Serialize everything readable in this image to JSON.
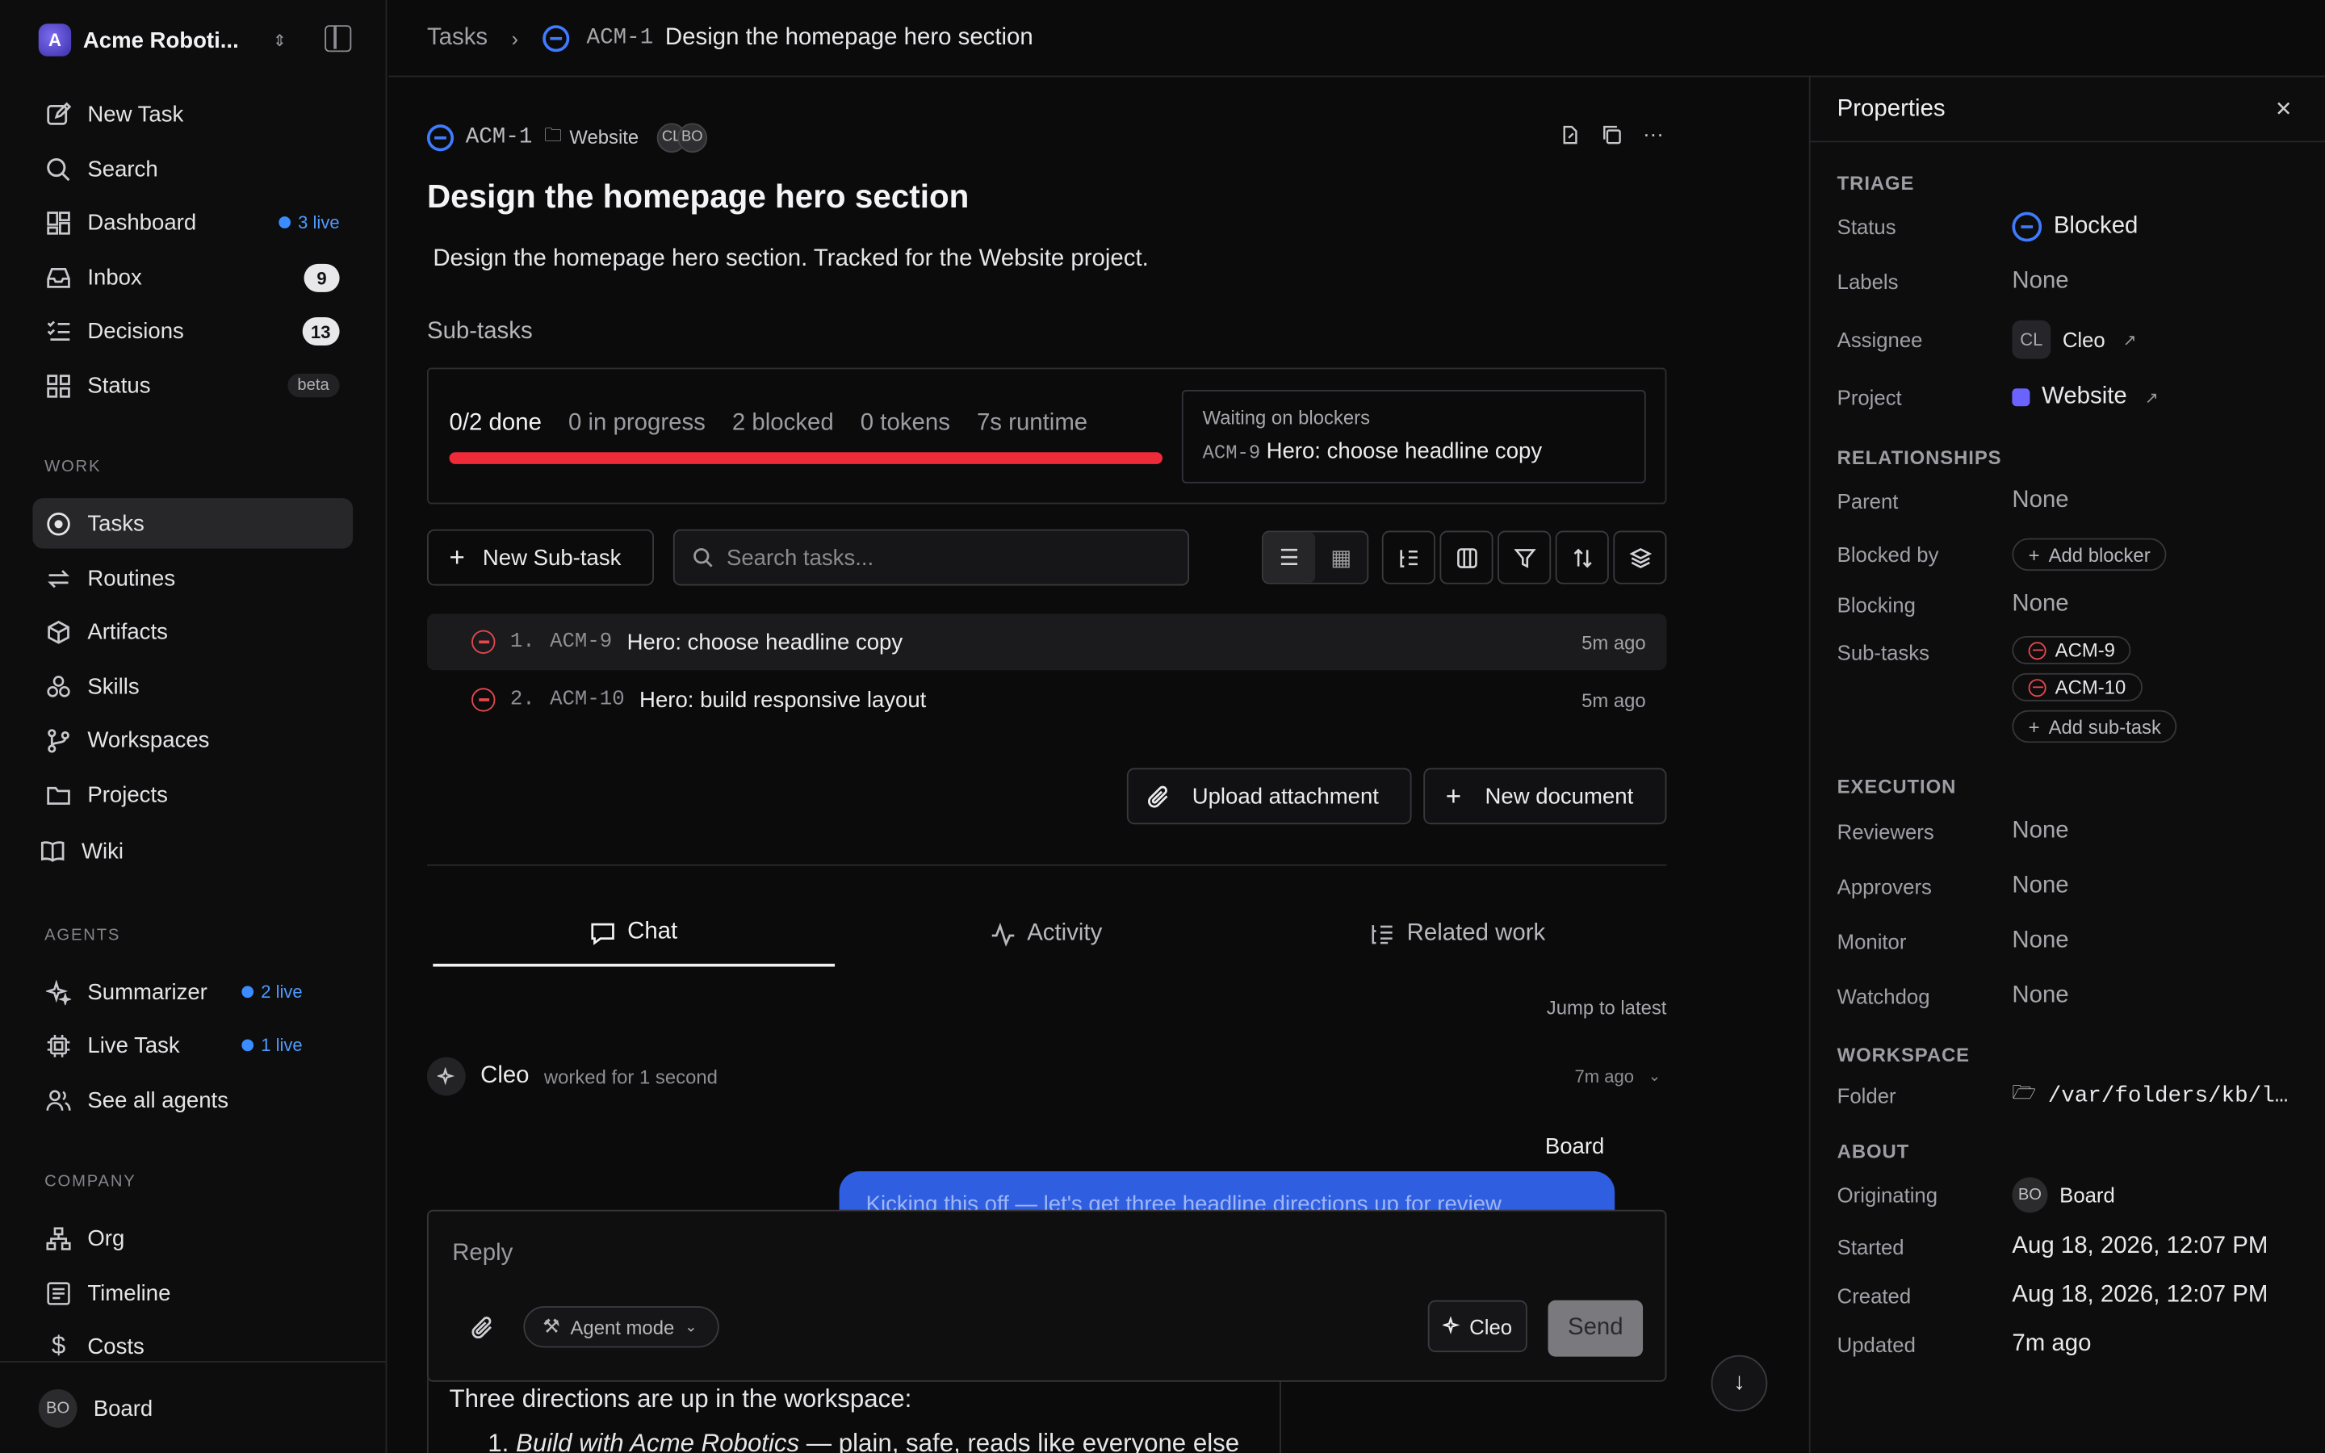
{
  "workspace": {
    "name": "Acme Roboti...",
    "logo_letter": "A"
  },
  "sidebar": {
    "top": [
      {
        "label": "New Task",
        "icon": "pencil-square-icon"
      },
      {
        "label": "Search",
        "icon": "search-icon"
      },
      {
        "label": "Dashboard",
        "icon": "dashboard-icon",
        "live": "3 live"
      },
      {
        "label": "Inbox",
        "icon": "inbox-icon",
        "badge": "9"
      },
      {
        "label": "Decisions",
        "icon": "checklist-icon",
        "badge": "13"
      },
      {
        "label": "Status",
        "icon": "grid-icon",
        "tag": "beta"
      }
    ],
    "work_label": "WORK",
    "work": [
      {
        "label": "Tasks",
        "icon": "target-icon",
        "active": true
      },
      {
        "label": "Routines",
        "icon": "repeat-icon"
      },
      {
        "label": "Artifacts",
        "icon": "cube-icon"
      },
      {
        "label": "Skills",
        "icon": "skills-icon"
      },
      {
        "label": "Workspaces",
        "icon": "branch-icon"
      },
      {
        "label": "Projects",
        "icon": "folder-icon"
      },
      {
        "label": "Wiki",
        "icon": "book-icon"
      }
    ],
    "agents_label": "AGENTS",
    "agents": [
      {
        "label": "Summarizer",
        "icon": "sparkle-icon",
        "live": "2 live"
      },
      {
        "label": "Live Task",
        "icon": "chip-icon",
        "live": "1 live"
      },
      {
        "label": "See all agents",
        "icon": "users-icon"
      }
    ],
    "company_label": "COMPANY",
    "company": [
      {
        "label": "Org",
        "icon": "org-icon"
      },
      {
        "label": "Timeline",
        "icon": "timeline-icon"
      },
      {
        "label": "Costs",
        "icon": "dollar-icon"
      }
    ],
    "user": {
      "initials": "BO",
      "name": "Board"
    }
  },
  "breadcrumb": {
    "root": "Tasks",
    "id": "ACM-1",
    "title": "Design the homepage hero section"
  },
  "task": {
    "id": "ACM-1",
    "project": "Website",
    "avatars": [
      "CL",
      "BO"
    ],
    "title": "Design the homepage hero section",
    "description": "Design the homepage hero section. Tracked for the Website project."
  },
  "subtasks": {
    "label": "Sub-tasks",
    "stats": {
      "done": "0/2 done",
      "in_progress": "0 in progress",
      "blocked": "2 blocked",
      "tokens": "0 tokens",
      "runtime": "7s runtime"
    },
    "progress_blocked_fraction": 1.0,
    "blockers_title": "Waiting on blockers",
    "blocker_id": "ACM-9",
    "blocker_title": "Hero: choose headline copy",
    "new_subtask_label": "New Sub-task",
    "search_placeholder": "Search tasks...",
    "rows": [
      {
        "num": "1.",
        "id": "ACM-9",
        "title": "Hero: choose headline copy",
        "time": "5m ago"
      },
      {
        "num": "2.",
        "id": "ACM-10",
        "title": "Hero: build responsive layout",
        "time": "5m ago"
      }
    ],
    "upload_label": "Upload attachment",
    "new_doc_label": "New document"
  },
  "tabs": [
    {
      "label": "Chat",
      "icon": "chat-icon"
    },
    {
      "label": "Activity",
      "icon": "activity-icon"
    },
    {
      "label": "Related work",
      "icon": "related-icon"
    }
  ],
  "chat": {
    "jump_label": "Jump to latest",
    "entry_author": "Cleo",
    "entry_meta": "worked for 1 second",
    "entry_time": "7m ago",
    "board_author": "Board",
    "bubble_text": "Kicking this off — let's get three headline directions up for review",
    "reply_placeholder": "Reply",
    "mode_label": "Agent mode",
    "agent_label": "Cleo",
    "send_label": "Send",
    "msg_line1": "Three directions are up in the workspace:",
    "msg_line2_num": "1.",
    "msg_line2_em": "Build with Acme Robotics",
    "msg_line2_rest": " — plain, safe, reads like everyone else"
  },
  "properties": {
    "title": "Properties",
    "triage_label": "TRIAGE",
    "status_key": "Status",
    "status_val": "Blocked",
    "labels_key": "Labels",
    "labels_val": "None",
    "assignee_key": "Assignee",
    "assignee_initials": "CL",
    "assignee_val": "Cleo",
    "project_key": "Project",
    "project_val": "Website",
    "rel_label": "RELATIONSHIPS",
    "parent_key": "Parent",
    "parent_val": "None",
    "blockedby_key": "Blocked by",
    "blockedby_btn": "Add blocker",
    "blocking_key": "Blocking",
    "blocking_val": "None",
    "subtasks_key": "Sub-tasks",
    "subtask_pills": [
      "ACM-9",
      "ACM-10"
    ],
    "add_subtask": "Add sub-task",
    "exec_label": "EXECUTION",
    "reviewers_key": "Reviewers",
    "reviewers_val": "None",
    "approvers_key": "Approvers",
    "approvers_val": "None",
    "monitor_key": "Monitor",
    "monitor_val": "None",
    "watchdog_key": "Watchdog",
    "watchdog_val": "None",
    "workspace_label": "WORKSPACE",
    "folder_key": "Folder",
    "folder_val": "/var/folders/kb/l…",
    "about_label": "ABOUT",
    "orig_key": "Originating",
    "orig_initials": "BO",
    "orig_val": "Board",
    "started_key": "Started",
    "started_val": "Aug 18, 2026, 12:07 PM",
    "created_key": "Created",
    "created_val": "Aug 18, 2026, 12:07 PM",
    "updated_key": "Updated",
    "updated_val": "7m ago"
  },
  "colors": {
    "accent_blue": "#3f7bff",
    "blocked_red": "#e5484d",
    "progress_red": "#ef2b3a",
    "live_blue": "#3b8cff",
    "project_purple": "#6b63ff"
  }
}
